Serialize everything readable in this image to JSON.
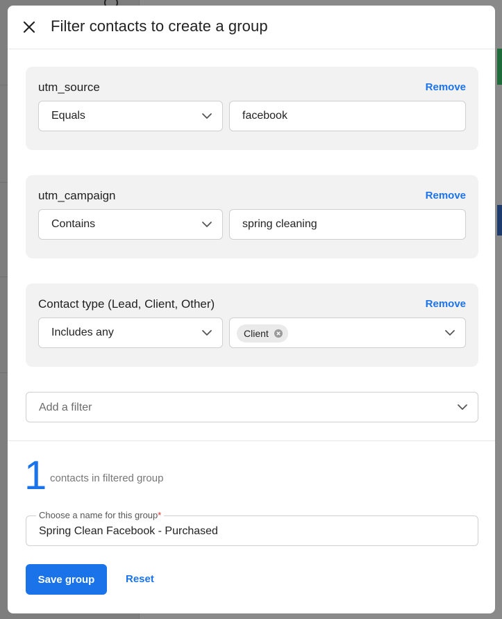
{
  "dialog": {
    "title": "Filter contacts to create a group"
  },
  "filters": [
    {
      "label": "utm_source",
      "remove_label": "Remove",
      "operator": "Equals",
      "value": "facebook"
    },
    {
      "label": "utm_campaign",
      "remove_label": "Remove",
      "operator": "Contains",
      "value": "spring cleaning"
    },
    {
      "label": "Contact type (Lead, Client, Other)",
      "remove_label": "Remove",
      "operator": "Includes any",
      "chips": [
        "Client"
      ]
    }
  ],
  "add_filter": {
    "placeholder": "Add a filter"
  },
  "summary": {
    "count": "1",
    "label": "contacts in filtered group"
  },
  "group_name": {
    "label": "Choose a name for this group",
    "required_mark": "*",
    "value": "Spring Clean Facebook - Purchased"
  },
  "actions": {
    "save_label": "Save group",
    "reset_label": "Reset"
  },
  "colors": {
    "accent": "#1a73e8",
    "card_bg": "#f2f2f2",
    "required": "#d93025"
  }
}
